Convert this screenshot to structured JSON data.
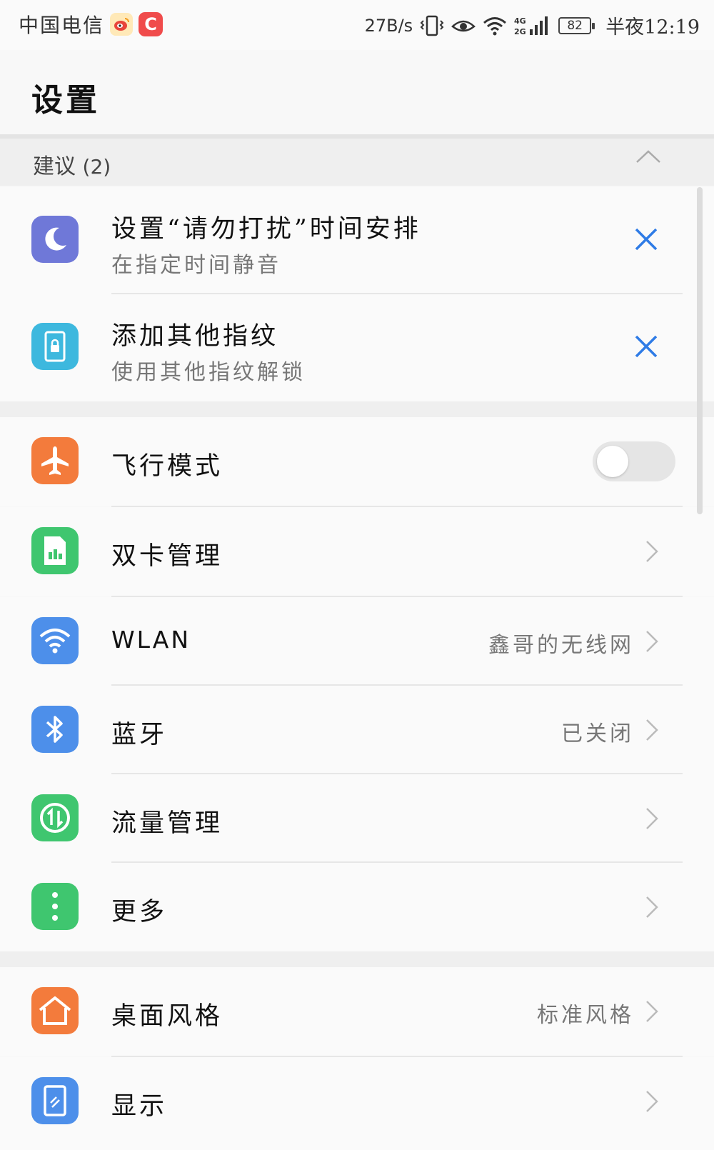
{
  "status_bar": {
    "carrier": "中国电信",
    "speed": "27B/s",
    "network": "4G 2G",
    "battery": "82",
    "time": "半夜12:19",
    "app_icons": [
      "weibo-icon",
      "c-app-icon"
    ]
  },
  "page": {
    "title": "设置"
  },
  "suggestions": {
    "label": "建议",
    "count": "(2)",
    "items": [
      {
        "title": "设置“请勿打扰”时间安排",
        "subtitle": "在指定时间静音",
        "icon": "moon-icon",
        "color": "#6f78d8"
      },
      {
        "title": "添加其他指纹",
        "subtitle": "使用其他指纹解锁",
        "icon": "fingerprint-phone-icon",
        "color": "#3db8de"
      }
    ]
  },
  "connectivity": {
    "items": [
      {
        "title": "飞行模式",
        "icon": "airplane-icon",
        "color": "#f37b3c",
        "toggle": false
      },
      {
        "title": "双卡管理",
        "icon": "sim-card-icon",
        "color": "#3fc66f",
        "value": ""
      },
      {
        "title": "WLAN",
        "icon": "wifi-icon",
        "color": "#4d8fea",
        "value": "鑫哥的无线网"
      },
      {
        "title": "蓝牙",
        "icon": "bluetooth-icon",
        "color": "#4d8fea",
        "value": "已关闭"
      },
      {
        "title": "流量管理",
        "icon": "data-usage-icon",
        "color": "#3fc66f",
        "value": ""
      },
      {
        "title": "更多",
        "icon": "more-dots-icon",
        "color": "#3fc66f",
        "value": ""
      }
    ]
  },
  "display": {
    "items": [
      {
        "title": "桌面风格",
        "icon": "home-icon",
        "color": "#f37b3c",
        "value": "标准风格"
      },
      {
        "title": "显示",
        "icon": "display-icon",
        "color": "#4d8fea",
        "value": ""
      }
    ]
  },
  "colors": {
    "accent_blue": "#2e7be6",
    "divider": "#e6e6e6",
    "background": "#fafafa"
  }
}
